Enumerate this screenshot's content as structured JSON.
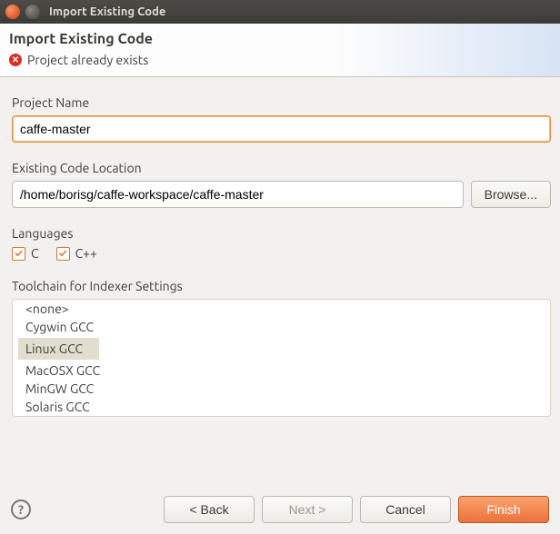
{
  "window": {
    "title": "Import Existing Code"
  },
  "header": {
    "title": "Import Existing Code",
    "error_message": "Project already exists"
  },
  "project_name": {
    "label": "Project Name",
    "value": "caffe-master"
  },
  "code_location": {
    "label": "Existing Code Location",
    "value": "/home/borisg/caffe-workspace/caffe-master",
    "browse_label": "Browse..."
  },
  "languages": {
    "label": "Languages",
    "options": [
      {
        "label": "C",
        "checked": true
      },
      {
        "label": "C++",
        "checked": true
      }
    ]
  },
  "toolchain": {
    "label": "Toolchain for Indexer Settings",
    "items": [
      {
        "label": "<none>",
        "selected": false
      },
      {
        "label": "Cygwin GCC",
        "selected": false
      },
      {
        "label": "Linux GCC",
        "selected": true
      },
      {
        "label": "MacOSX GCC",
        "selected": false
      },
      {
        "label": "MinGW GCC",
        "selected": false
      },
      {
        "label": "Solaris GCC",
        "selected": false
      }
    ]
  },
  "footer": {
    "help": "?",
    "back": "< Back",
    "next": "Next >",
    "cancel": "Cancel",
    "finish": "Finish"
  }
}
